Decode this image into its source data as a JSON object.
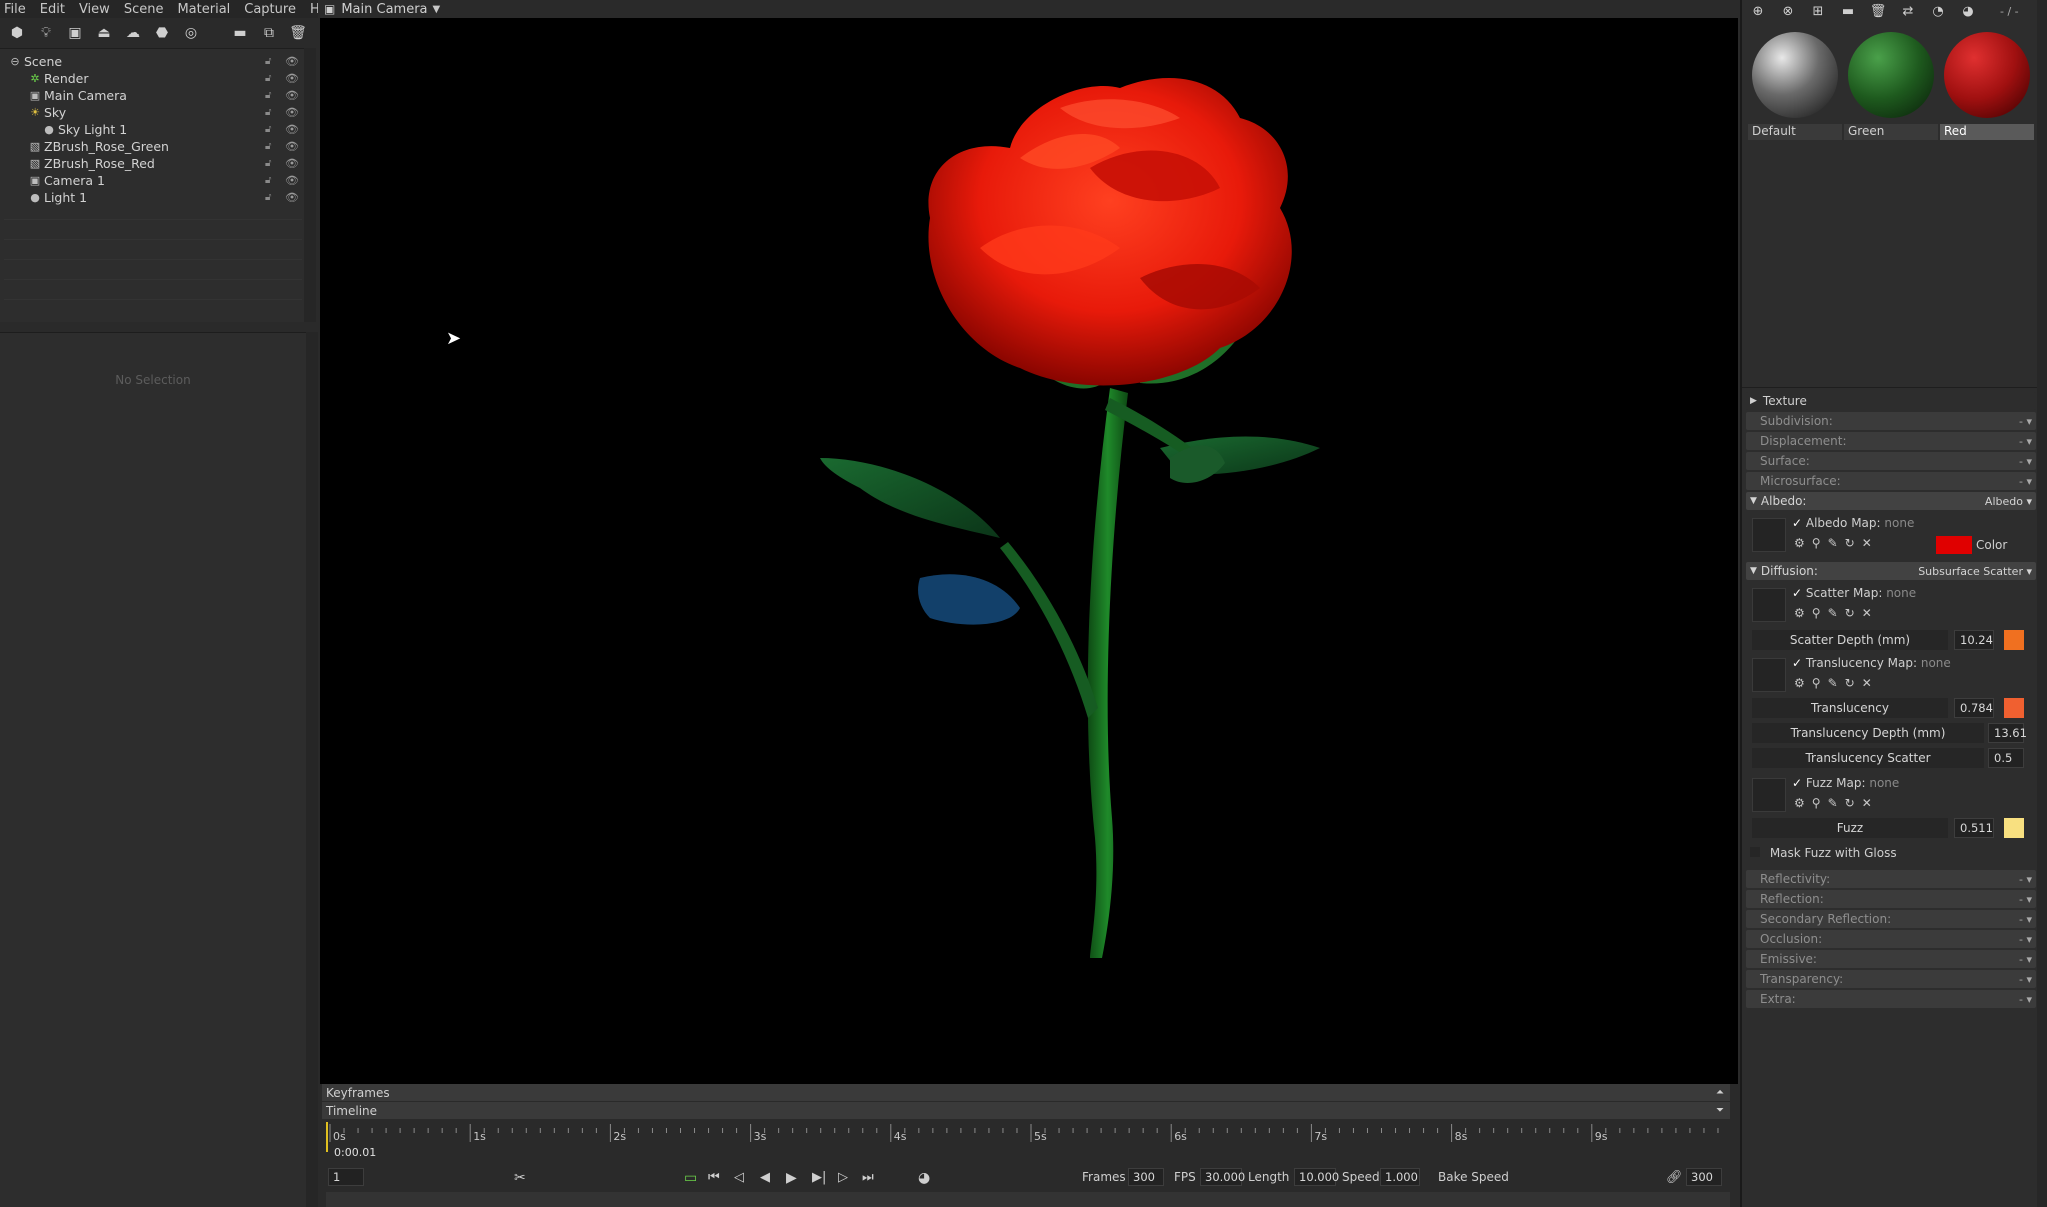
{
  "menu": [
    "File",
    "Edit",
    "View",
    "Scene",
    "Material",
    "Capture",
    "Help"
  ],
  "left_toolbar_icons": [
    "new-object-icon",
    "light-icon",
    "camera-icon",
    "plane-icon",
    "sky-icon",
    "shape-icon",
    "render-sphere-icon",
    "folder-icon",
    "duplicate-icon",
    "delete-icon"
  ],
  "scene_tree": [
    {
      "label": "Scene",
      "icon": "scene-icon",
      "depth": 0
    },
    {
      "label": "Render",
      "icon": "render-gear-icon",
      "depth": 1
    },
    {
      "label": "Main Camera",
      "icon": "camera-icon",
      "depth": 1
    },
    {
      "label": "Sky",
      "icon": "sky-icon",
      "depth": 1
    },
    {
      "label": "Sky Light 1",
      "icon": "light-icon",
      "depth": 2
    },
    {
      "label": "ZBrush_Rose_Green",
      "icon": "mesh-icon",
      "depth": 1
    },
    {
      "label": "ZBrush_Rose_Red",
      "icon": "mesh-icon",
      "depth": 1
    },
    {
      "label": "Camera 1",
      "icon": "camera-icon",
      "depth": 1
    },
    {
      "label": "Light 1",
      "icon": "light-icon",
      "depth": 1
    }
  ],
  "properties_empty": "No Selection",
  "viewport": {
    "title": "Main Camera"
  },
  "materials": [
    {
      "name": "Default",
      "color": "#8a8a8a"
    },
    {
      "name": "Green",
      "color": "#1e5a1e"
    },
    {
      "name": "Red",
      "color": "#a01010"
    }
  ],
  "material_topbar_value": "- / -",
  "material_sections_top": [
    {
      "label": "Texture",
      "open": false,
      "value": ""
    },
    {
      "label": "Subdivision:",
      "value": "-"
    },
    {
      "label": "Displacement:",
      "value": "-"
    },
    {
      "label": "Surface:",
      "value": "-"
    },
    {
      "label": "Microsurface:",
      "value": "-"
    }
  ],
  "albedo": {
    "label": "Albedo:",
    "value": "Albedo",
    "map_label": "Albedo Map:",
    "map_value": "none",
    "color_label": "Color",
    "color": "#e00000"
  },
  "diffusion": {
    "label": "Diffusion:",
    "value": "Subsurface Scatter",
    "scatter_map_label": "Scatter Map:",
    "scatter_map_value": "none",
    "scatter_depth_label": "Scatter Depth (mm)",
    "scatter_depth_value": "10.24",
    "scatter_color": "#f07020",
    "translucency_map_label": "Translucency Map:",
    "translucency_map_value": "none",
    "translucency_label": "Translucency",
    "translucency_value": "0.784",
    "translucency_color": "#f06030",
    "translucency_depth_label": "Translucency Depth (mm)",
    "translucency_depth_value": "13.61",
    "translucency_scatter_label": "Translucency Scatter",
    "translucency_scatter_value": "0.5",
    "fuzz_map_label": "Fuzz Map:",
    "fuzz_map_value": "none",
    "fuzz_label": "Fuzz",
    "fuzz_value": "0.511",
    "fuzz_color": "#f8e080",
    "mask_label": "Mask Fuzz with Gloss"
  },
  "material_sections_bottom": [
    {
      "label": "Reflectivity:",
      "value": "-"
    },
    {
      "label": "Reflection:",
      "value": "-"
    },
    {
      "label": "Secondary Reflection:",
      "value": "-"
    },
    {
      "label": "Occlusion:",
      "value": "-"
    },
    {
      "label": "Emissive:",
      "value": "-"
    },
    {
      "label": "Transparency:",
      "value": "-"
    },
    {
      "label": "Extra:",
      "value": "-"
    }
  ],
  "timeline": {
    "keyframes_label": "Keyframes",
    "timeline_label": "Timeline",
    "time_display": "0:00.01",
    "ticks": [
      "0s",
      "1s",
      "2s",
      "3s",
      "4s",
      "5s",
      "6s",
      "7s",
      "8s",
      "9s"
    ],
    "frame_value": "1",
    "frames_label": "Frames",
    "frames_value": "300",
    "fps_label": "FPS",
    "fps_value": "30.000",
    "length_label": "Length",
    "length_value": "10.000",
    "speed_label": "Speed",
    "speed_value": "1.000",
    "bake_label": "Bake Speed",
    "end_value": "300"
  }
}
